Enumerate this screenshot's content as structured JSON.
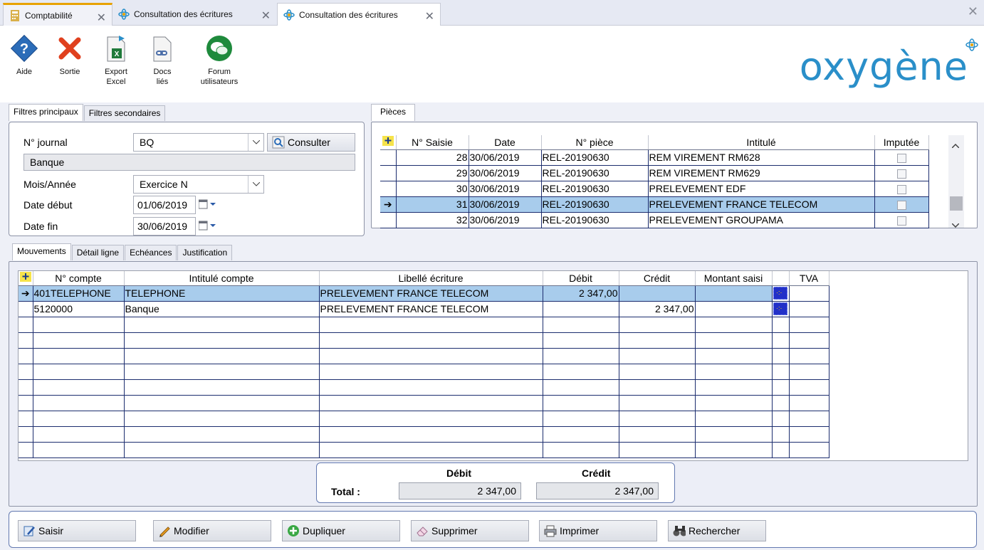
{
  "tabs": [
    {
      "label": "Comptabilité"
    },
    {
      "label": "Consultation des écritures"
    },
    {
      "label": "Consultation des écritures"
    }
  ],
  "toolbar": {
    "aide": "Aide",
    "sortie": "Sortie",
    "export_1": "Export",
    "export_2": "Excel",
    "docs_1": "Docs",
    "docs_2": "liés",
    "forum_1": "Forum",
    "forum_2": "utilisateurs"
  },
  "logo": "oxygène",
  "filters": {
    "tab_principal": "Filtres principaux",
    "tab_secondaire": "Filtres secondaires",
    "journal_label": "N° journal",
    "journal_value": "BQ",
    "consult_label": "Consulter",
    "journal_name": "Banque",
    "period_label": "Mois/Année",
    "period_value": "Exercice N",
    "start_label": "Date début",
    "start_value": "01/06/2019",
    "end_label": "Date fin",
    "end_value": "30/06/2019"
  },
  "pieces": {
    "tab": "Pièces",
    "columns": [
      "N° Saisie",
      "Date",
      "N° pièce",
      "Intitulé",
      "Imputée"
    ],
    "rows": [
      {
        "saisie": "28",
        "date": "30/06/2019",
        "piece": "REL-20190630",
        "intitule": "REM VIREMENT RM628"
      },
      {
        "saisie": "29",
        "date": "30/06/2019",
        "piece": "REL-20190630",
        "intitule": "REM VIREMENT RM629"
      },
      {
        "saisie": "30",
        "date": "30/06/2019",
        "piece": "REL-20190630",
        "intitule": "PRELEVEMENT EDF"
      },
      {
        "saisie": "31",
        "date": "30/06/2019",
        "piece": "REL-20190630",
        "intitule": "PRELEVEMENT FRANCE TELECOM"
      },
      {
        "saisie": "32",
        "date": "30/06/2019",
        "piece": "REL-20190630",
        "intitule": "PRELEVEMENT GROUPAMA"
      }
    ]
  },
  "movements": {
    "tabs": [
      "Mouvements",
      "Détail ligne",
      "Echéances",
      "Justification"
    ],
    "columns": [
      "N° compte",
      "Intitulé compte",
      "Libellé écriture",
      "Débit",
      "Crédit",
      "Montant saisi",
      "TVA"
    ],
    "rows": [
      {
        "compte": "401TELEPHONE",
        "intitule": "TELEPHONE",
        "libelle": "PRELEVEMENT FRANCE TELECOM",
        "debit": "2 347,00",
        "credit": ""
      },
      {
        "compte": "5120000",
        "intitule": "Banque",
        "libelle": "PRELEVEMENT FRANCE TELECOM",
        "debit": "",
        "credit": "2 347,00"
      }
    ]
  },
  "totals": {
    "debit_label": "Débit",
    "credit_label": "Crédit",
    "total_label": "Total :",
    "debit": "2 347,00",
    "credit": "2 347,00"
  },
  "actions": {
    "saisir": "Saisir",
    "modifier": "Modifier",
    "dupliquer": "Dupliquer",
    "supprimer": "Supprimer",
    "imprimer": "Imprimer",
    "rechercher": "Rechercher"
  },
  "colors": {
    "selection": "#a8ccec",
    "accent": "#2a8fc9",
    "grid_line": "#1c2d6e"
  }
}
